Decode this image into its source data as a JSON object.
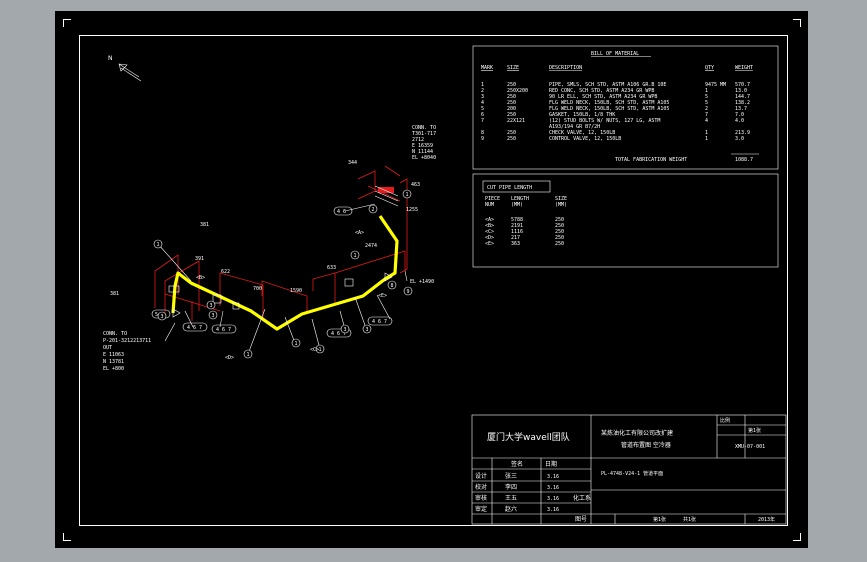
{
  "north_label": "N",
  "bom": {
    "title": "BILL OF MATERIAL",
    "headers": [
      "MARK",
      "SIZE",
      "DESCRIPTION",
      "QTY",
      "WEIGHT"
    ],
    "rows": [
      [
        "1",
        "250",
        "PIPE, SMLS, SCH STD, ASTM A106 GR.B 10E",
        "9475 MM",
        "570.7"
      ],
      [
        "2",
        "250X200",
        "RED CONC, SCH STD, ASTM A234 GR WPB",
        "1",
        "13.0"
      ],
      [
        "3",
        "250",
        "90 LR ELL, SCH STD, ASTM A234 GR WPB",
        "5",
        "144.7"
      ],
      [
        "4",
        "250",
        "FLG WELD NECK, 150LB, SCH STD, ASTM A105",
        "5",
        "138.2"
      ],
      [
        "5",
        "200",
        "FLG WELD NECK, 150LB, SCH STD, ASTM A105",
        "2",
        "13.7"
      ],
      [
        "6",
        "250",
        "GASKET, 150LB, 1/8 THK",
        "7",
        "7.0"
      ],
      [
        "7",
        "22X121",
        "(12) STUD BOLTS W/ NUTS, 127 LG, ASTM",
        "4",
        "4.0"
      ],
      [
        "",
        "",
        "A193/194 GR B7/2H",
        "",
        ""
      ],
      [
        "8",
        "250",
        "CHECK VALVE, 12, 150LB",
        "1",
        "213.9"
      ],
      [
        "9",
        "250",
        "CONTROL VALVE, 12, 150LB",
        "1",
        "3.0"
      ]
    ],
    "total_label": "TOTAL FABRICATION WEIGHT",
    "total_value": "1088.7"
  },
  "cut_pipe": {
    "title": "CUT PIPE LENGTH",
    "headers": [
      "PIECE NUM",
      "LENGTH (MM)",
      "SIZE (MM)"
    ],
    "rows": [
      [
        "<A>",
        "5788",
        "250"
      ],
      [
        "<B>",
        "2191",
        "250"
      ],
      [
        "<C>",
        "1116",
        "250"
      ],
      [
        "<D>",
        "217",
        "250"
      ],
      [
        "<E>",
        "363",
        "250"
      ]
    ]
  },
  "annotations": {
    "conn_top": [
      "CONN. TO",
      "T301-717",
      "2712",
      "E 16359",
      "N 11144",
      "EL +8040"
    ],
    "conn_left": [
      "CONN. TO",
      "P-201-3212213711",
      "OUT",
      "E 11063",
      "N 13781",
      "EL +800"
    ],
    "el_right": "EL +1490",
    "dims": [
      "381",
      "381",
      "391",
      "622",
      "700",
      "1590",
      "633",
      "1255",
      "2474",
      "344",
      "463"
    ],
    "callouts": [
      "4 6",
      "4 6 7",
      "4 6 7",
      "4 6 7",
      "4 6 7",
      "5 6"
    ],
    "balloons": [
      "1",
      "3",
      "3",
      "3",
      "1",
      "1",
      "1",
      "3",
      "3",
      "8",
      "9",
      "1",
      "2",
      "1"
    ],
    "pieces": [
      "<A>",
      "<B>",
      "<C>",
      "<D>",
      "<E>"
    ]
  },
  "title_block": {
    "org_left": "厦门大学wavell团队",
    "project": "某炼油化工有限公司改扩建",
    "subject": "管道布置图 空冷器",
    "drawing_no": "XMU-07-001",
    "scale_label": "比例",
    "sheet_label": "第1张",
    "roles": [
      {
        "role": "设计",
        "name": "张三",
        "date": "3.16"
      },
      {
        "role": "校对",
        "name": "李四",
        "date": "3.16"
      },
      {
        "role": "审核",
        "name": "王五",
        "date": "3.16"
      },
      {
        "role": "审定",
        "name": "赵六",
        "date": "3.16"
      }
    ],
    "col_headers": [
      "签名",
      "日期"
    ],
    "unit": "化工系",
    "footer": [
      "图号",
      "第1张",
      "共1张",
      "2013年"
    ],
    "description": "PL-4748-V24-1 管道平面"
  }
}
